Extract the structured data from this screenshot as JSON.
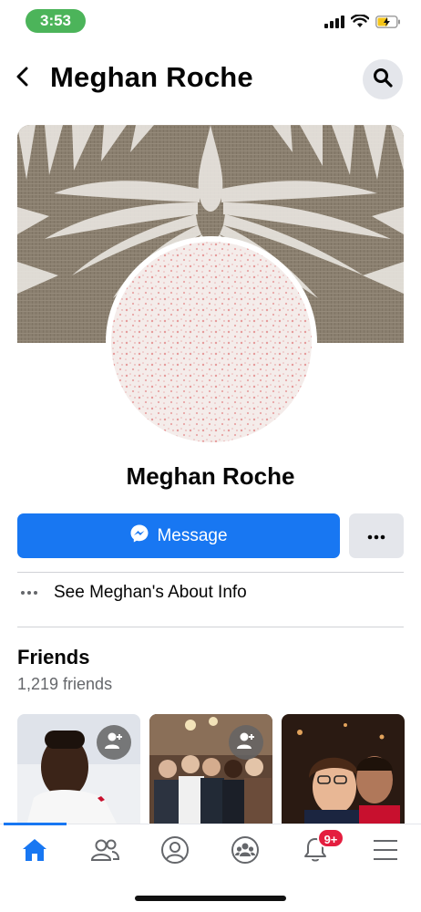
{
  "status_bar": {
    "time": "3:53",
    "icons": [
      "cellular-signal-icon",
      "wifi-icon",
      "battery-charging-icon"
    ]
  },
  "header": {
    "title": "Meghan Roche",
    "back_icon": "chevron-left-icon",
    "search_icon": "search-icon"
  },
  "profile": {
    "name": "Meghan Roche"
  },
  "actions": {
    "message_label": "Message",
    "message_icon": "messenger-icon",
    "more_icon": "more-horizontal-icon"
  },
  "about": {
    "label": "See Meghan's About Info",
    "icon": "more-horizontal-icon"
  },
  "friends": {
    "title": "Friends",
    "count": "1,219 friends",
    "cards": [
      {
        "icon": "add-friend-icon"
      },
      {
        "icon": "add-friend-icon"
      },
      {}
    ]
  },
  "tab_bar": {
    "tabs": [
      {
        "name": "home",
        "icon": "home-icon",
        "active": true
      },
      {
        "name": "friends",
        "icon": "friends-icon"
      },
      {
        "name": "profile",
        "icon": "profile-icon"
      },
      {
        "name": "groups",
        "icon": "groups-icon"
      },
      {
        "name": "notifications",
        "icon": "bell-icon",
        "badge": "9+"
      },
      {
        "name": "menu",
        "icon": "menu-icon"
      }
    ]
  },
  "colors": {
    "accent": "#1877f2",
    "badge": "#e41e3f",
    "status_pill": "#4cb45a"
  }
}
